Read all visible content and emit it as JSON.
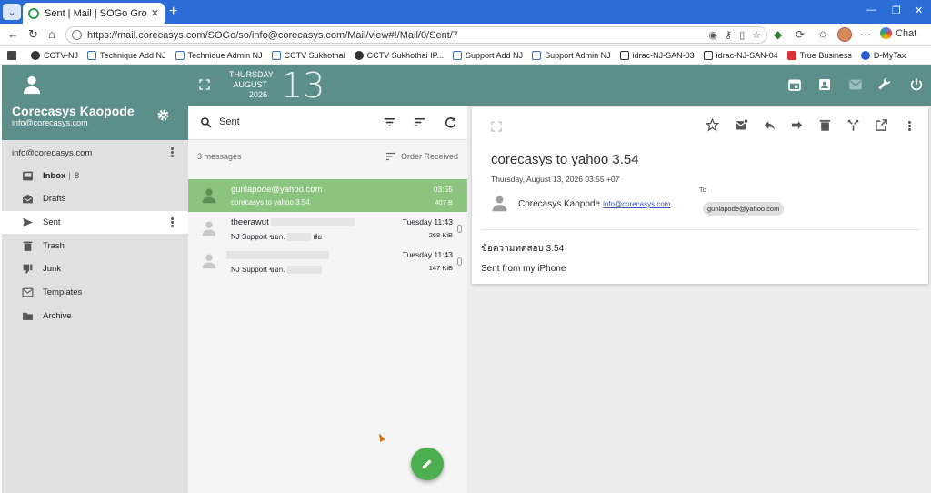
{
  "browser": {
    "tab_title": "Sent | Mail | SOGo Groupware",
    "tab_close": "✕",
    "new_tab": "+",
    "url": "https://mail.corecasys.com/SOGo/so/info@corecasys.com/Mail/view#!/Mail/0/Sent/7",
    "chat_label": "Chat",
    "bookmarks": [
      "CCTV-NJ",
      "Technique Add NJ",
      "Technique Admin NJ",
      "CCTV Sukhothai",
      "CCTV Sukhothai IP...",
      "Support Add NJ",
      "Support Admin NJ",
      "idrac-NJ-SAN-03",
      "idrac-NJ-SAN-04",
      "True Business",
      "D-MyTax"
    ]
  },
  "user": {
    "name": "Corecasys Kaopode",
    "email": "info@corecasys.com"
  },
  "sidebar": {
    "account": "info@corecasys.com",
    "folders": [
      {
        "label": "Inbox",
        "count": "8"
      },
      {
        "label": "Drafts"
      },
      {
        "label": "Sent"
      },
      {
        "label": "Trash"
      },
      {
        "label": "Junk"
      },
      {
        "label": "Templates"
      },
      {
        "label": "Archive"
      }
    ]
  },
  "datebar": {
    "weekday": "THURSDAY",
    "month": "AUGUST",
    "year": "2026",
    "day": "13"
  },
  "list": {
    "search_label": "Sent",
    "message_count": "3 messages",
    "order_label": "Order Received",
    "messages": [
      {
        "from": "gunlapode@yahoo.com",
        "subject": "corecasys to yahoo 3.54",
        "date": "03:55",
        "size": "407 B"
      },
      {
        "from": "theerawut",
        "subject": "NJ Support ขอก.",
        "subject_tail": "ษัย",
        "date": "Tuesday 11:43",
        "size": "268 KiB"
      },
      {
        "from": "",
        "subject": "NJ Support ขอก.",
        "date": "Tuesday 11:43",
        "size": "147 KiB"
      }
    ]
  },
  "message": {
    "subject": "corecasys to yahoo 3.54",
    "date": "Thursday, August 13, 2026 03:55 +07",
    "sender_name": "Corecasys Kaopode",
    "sender_email": "info@corecasys.com",
    "to_label": "To",
    "to": "gunlapode@yahoo.com",
    "body_line1": "ข้อความทดสอบ 3.54",
    "body_line2": "Sent from my iPhone"
  },
  "colors": {
    "accent": "#5c8e8a",
    "selected": "#8bc47e",
    "fab": "#4caf50"
  }
}
